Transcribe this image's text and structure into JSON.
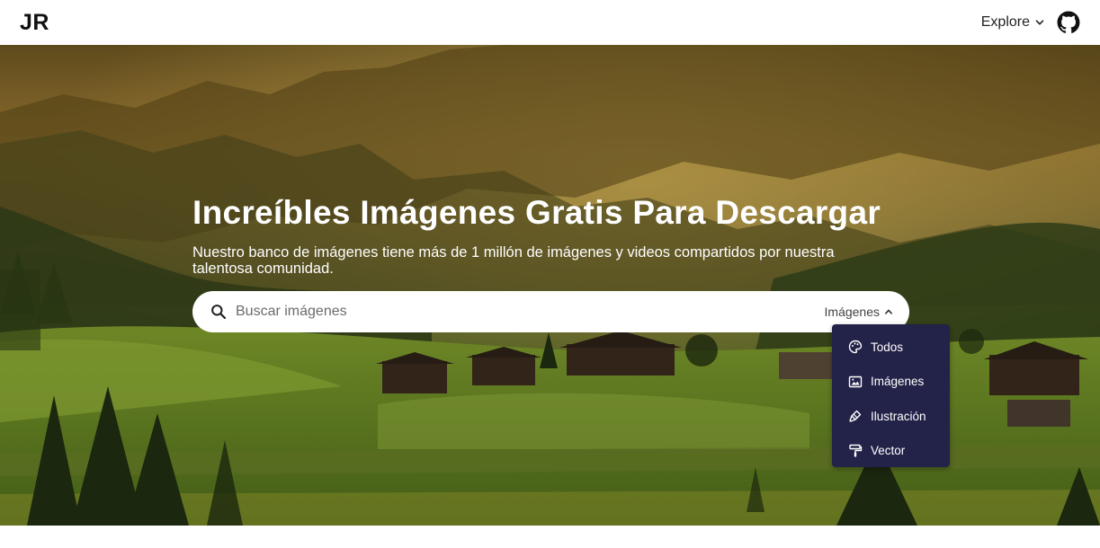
{
  "navbar": {
    "logo": "JR",
    "explore_label": "Explore",
    "chevron_icon": "chevron-down-icon",
    "github_icon": "github-icon"
  },
  "hero": {
    "title": "Increíbles Imágenes Gratis Para Descargar",
    "subtitle": "Nuestro banco de imágenes tiene más de 1 millón de imágenes y videos compartidos por nuestra talentosa comunidad."
  },
  "search": {
    "placeholder": "Buscar imágenes",
    "type_label": "Imágenes",
    "search_icon": "search-icon",
    "toggle_icon": "chevron-up-icon"
  },
  "dropdown": {
    "items": [
      {
        "label": "Todos",
        "icon": "palette-icon"
      },
      {
        "label": "Imágenes",
        "icon": "image-icon"
      },
      {
        "label": "Ilustración",
        "icon": "brush-icon"
      },
      {
        "label": "Vector",
        "icon": "paint-roller-icon"
      }
    ],
    "background_color": "#232248"
  }
}
